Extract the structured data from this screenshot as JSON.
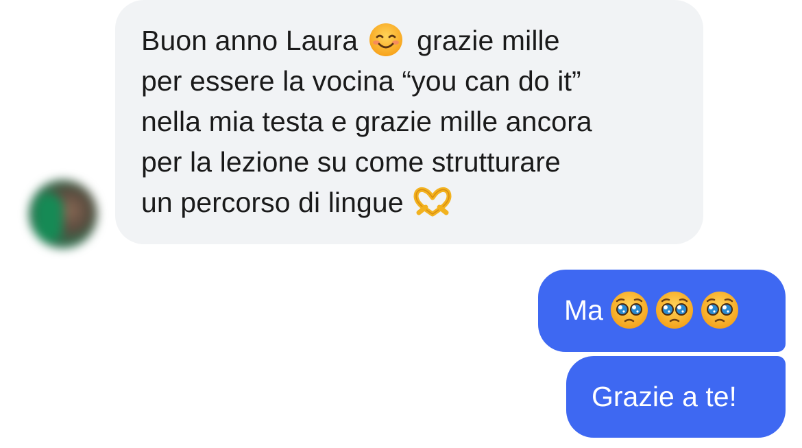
{
  "conversation": {
    "contact": {
      "avatar_icon": "contact-avatar-blurred"
    },
    "incoming_message": {
      "lines": [
        {
          "before_emoji": "Buon anno Laura",
          "emoji": "smiling-face-icon",
          "after_emoji": "grazie mille"
        },
        {
          "text": "per essere la vocina “you can do it”"
        },
        {
          "text": "nella mia testa e grazie mille ancora"
        },
        {
          "text": "per la lezione su come strutturare"
        },
        {
          "before_emoji": "un percorso di lingue",
          "emoji": "heart-hands-icon"
        }
      ],
      "bubble_color": "#f1f3f5",
      "text_color": "#1a1a1a"
    },
    "outgoing_messages": [
      {
        "text": "Ma",
        "emojis": [
          "pleading-face-icon",
          "pleading-face-icon",
          "pleading-face-icon"
        ]
      },
      {
        "text": "Grazie a te!"
      }
    ],
    "outgoing_bubble_color": "#3e68f2",
    "outgoing_text_color": "#ffffff"
  }
}
